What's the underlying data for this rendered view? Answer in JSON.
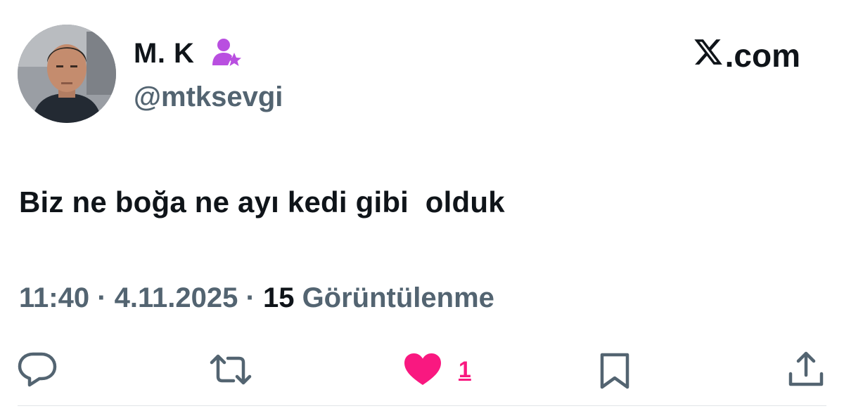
{
  "colors": {
    "text_primary": "#0f1419",
    "text_secondary": "#536471",
    "like_pink": "#f91880",
    "badge_purple": "#b94fe0",
    "divider": "#e1e4e7"
  },
  "author": {
    "display_name": "M. K",
    "handle": "@mtksevgi",
    "avatar_icon": "profile-photo",
    "badge_icon": "person-star-badge-icon"
  },
  "brand": {
    "label": ".com",
    "logo_icon": "x-logo-icon"
  },
  "tweet": {
    "text": "Biz ne boğa ne ayı kedi gibi  olduk"
  },
  "meta": {
    "time": "11:40",
    "separator1": " · ",
    "date": "4.11.2025",
    "separator2": " · ",
    "views_count": "15",
    "views_label": " Görüntülenme"
  },
  "actions": {
    "reply_icon": "reply-bubble-icon",
    "repost_icon": "repost-arrows-icon",
    "like_icon": "heart-filled-icon",
    "like_count": "1",
    "bookmark_icon": "bookmark-icon",
    "share_icon": "share-upload-icon"
  }
}
